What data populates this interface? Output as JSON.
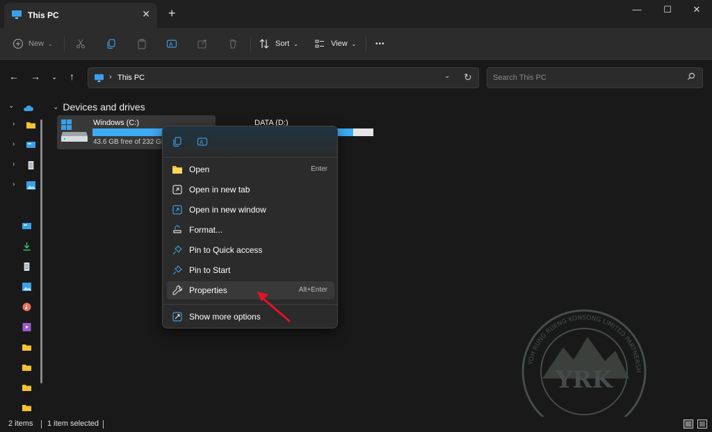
{
  "window": {
    "tab_title": "This PC",
    "new_tab": "+",
    "controls": {
      "minimize": "—",
      "maximize": "☐",
      "close": "✕"
    }
  },
  "toolbar": {
    "new_label": "New",
    "sort_label": "Sort",
    "view_label": "View",
    "more_label": "•••"
  },
  "address": {
    "crumb": "This PC",
    "search_placeholder": "Search This PC"
  },
  "section": {
    "title": "Devices and drives"
  },
  "drives": [
    {
      "name": "Windows (C:)",
      "free_text": "43.6 GB free of 232 GB",
      "used_fraction": 0.81
    },
    {
      "name": "DATA (D:)",
      "used_fraction": 0.45
    }
  ],
  "context_menu": {
    "items": [
      {
        "label": "Open",
        "shortcut": "Enter",
        "icon": "folder-icon"
      },
      {
        "label": "Open in new tab",
        "shortcut": "",
        "icon": "open-tab-icon"
      },
      {
        "label": "Open in new window",
        "shortcut": "",
        "icon": "open-window-icon"
      },
      {
        "label": "Format...",
        "shortcut": "",
        "icon": "format-icon"
      },
      {
        "label": "Pin to Quick access",
        "shortcut": "",
        "icon": "pin-icon"
      },
      {
        "label": "Pin to Start",
        "shortcut": "",
        "icon": "pin-icon"
      },
      {
        "label": "Properties",
        "shortcut": "Alt+Enter",
        "icon": "wrench-icon"
      },
      {
        "label": "Show more options",
        "shortcut": "",
        "icon": "show-more-icon"
      }
    ],
    "hovered": "Properties"
  },
  "status": {
    "items_count": "2 items",
    "selected": "1 item selected"
  },
  "watermark": {
    "text": "YRK",
    "arc_text": "YOH RUNG RUENG KONSONG LIMITED PARTNERSHIP"
  },
  "colors": {
    "accent": "#3dacf7",
    "arrow": "#e81123",
    "background": "#191919",
    "menu_bg": "#2b2b2b"
  }
}
